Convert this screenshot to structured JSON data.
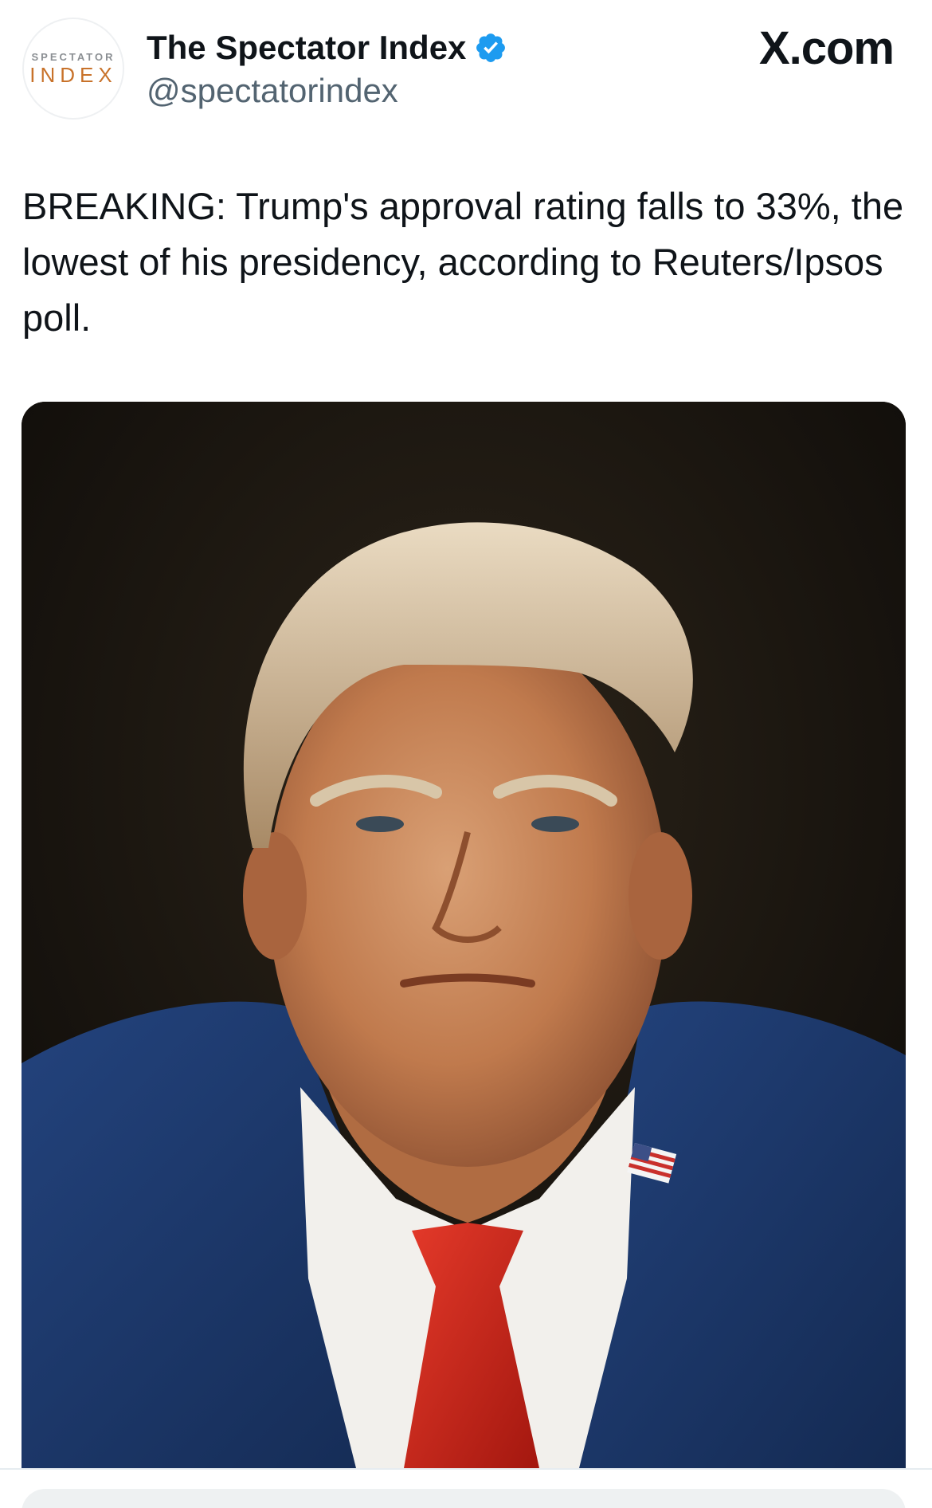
{
  "header": {
    "avatar_top_text": "SPECTATOR",
    "avatar_bottom_text": "INDEX",
    "display_name": "The Spectator Index",
    "handle": "@spectatorindex",
    "site_label": "X.com",
    "verified_color": "#1d9bf0"
  },
  "tweet": {
    "text": "BREAKING: Trump's approval rating falls to 33%, the lowest of his presidency, according to Reuters/Ipsos poll."
  },
  "media": {
    "colors": {
      "background": "#14100c",
      "suit": "#1e3a6e",
      "shirt": "#f2f0ec",
      "tie": "#d4231d",
      "skin": "#c98a5e",
      "hair": "#d8c2a0"
    }
  }
}
